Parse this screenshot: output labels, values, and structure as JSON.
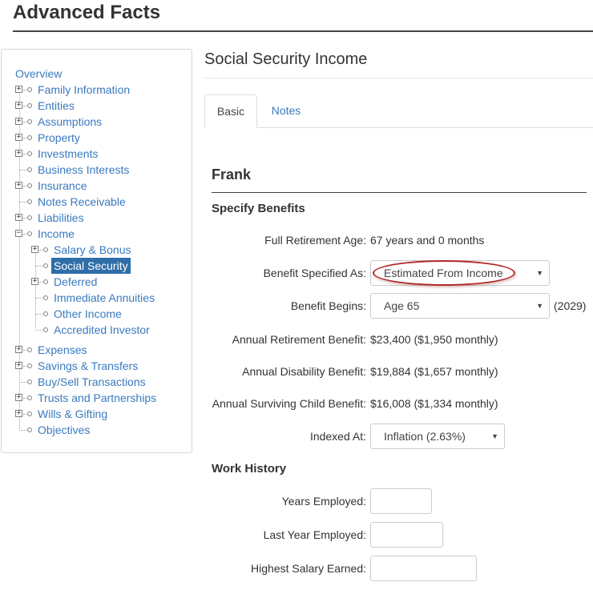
{
  "header": {
    "title": "Advanced Facts"
  },
  "sidebar": {
    "items": [
      {
        "label": "Overview"
      },
      {
        "label": "Family Information"
      },
      {
        "label": "Entities"
      },
      {
        "label": "Assumptions"
      },
      {
        "label": "Property"
      },
      {
        "label": "Investments"
      },
      {
        "label": "Business Interests"
      },
      {
        "label": "Insurance"
      },
      {
        "label": "Notes Receivable"
      },
      {
        "label": "Liabilities"
      },
      {
        "label": "Income"
      },
      {
        "label": "Salary & Bonus"
      },
      {
        "label": "Social Security"
      },
      {
        "label": "Deferred"
      },
      {
        "label": "Immediate Annuities"
      },
      {
        "label": "Other Income"
      },
      {
        "label": "Accredited Investor"
      },
      {
        "label": "Expenses"
      },
      {
        "label": "Savings & Transfers"
      },
      {
        "label": "Buy/Sell Transactions"
      },
      {
        "label": "Trusts and Partnerships"
      },
      {
        "label": "Wills & Gifting"
      },
      {
        "label": "Objectives"
      }
    ],
    "expand_glyph": "+",
    "collapse_glyph": "−"
  },
  "main": {
    "title": "Social Security Income",
    "tabs": [
      {
        "label": "Basic"
      },
      {
        "label": "Notes"
      }
    ],
    "person": "Frank",
    "specify_benefits": {
      "heading": "Specify Benefits",
      "full_retirement_age": {
        "label": "Full Retirement Age:",
        "value": "67 years and 0 months"
      },
      "benefit_specified_as": {
        "label": "Benefit Specified As:",
        "value": "Estimated From Income"
      },
      "benefit_begins": {
        "label": "Benefit Begins:",
        "value": "Age 65",
        "suffix": "(2029)"
      },
      "annual_retirement": {
        "label": "Annual Retirement Benefit:",
        "value": "$23,400 ($1,950 monthly)"
      },
      "annual_disability": {
        "label": "Annual Disability Benefit:",
        "value": "$19,884 ($1,657 monthly)"
      },
      "annual_surviving_child": {
        "label": "Annual Surviving Child Benefit:",
        "value": "$16,008 ($1,334 monthly)"
      },
      "indexed_at": {
        "label": "Indexed At:",
        "value": "Inflation (2.63%)"
      }
    },
    "work_history": {
      "heading": "Work History",
      "years_employed": {
        "label": "Years Employed:",
        "value": ""
      },
      "last_year_employed": {
        "label": "Last Year Employed:",
        "value": ""
      },
      "highest_salary": {
        "label": "Highest Salary Earned:",
        "value": ""
      }
    },
    "dropdown_arrow": "▼"
  },
  "colors": {
    "link": "#3a7abf",
    "selected_bg": "#2f6ea8",
    "annotation": "#b02a2a"
  }
}
